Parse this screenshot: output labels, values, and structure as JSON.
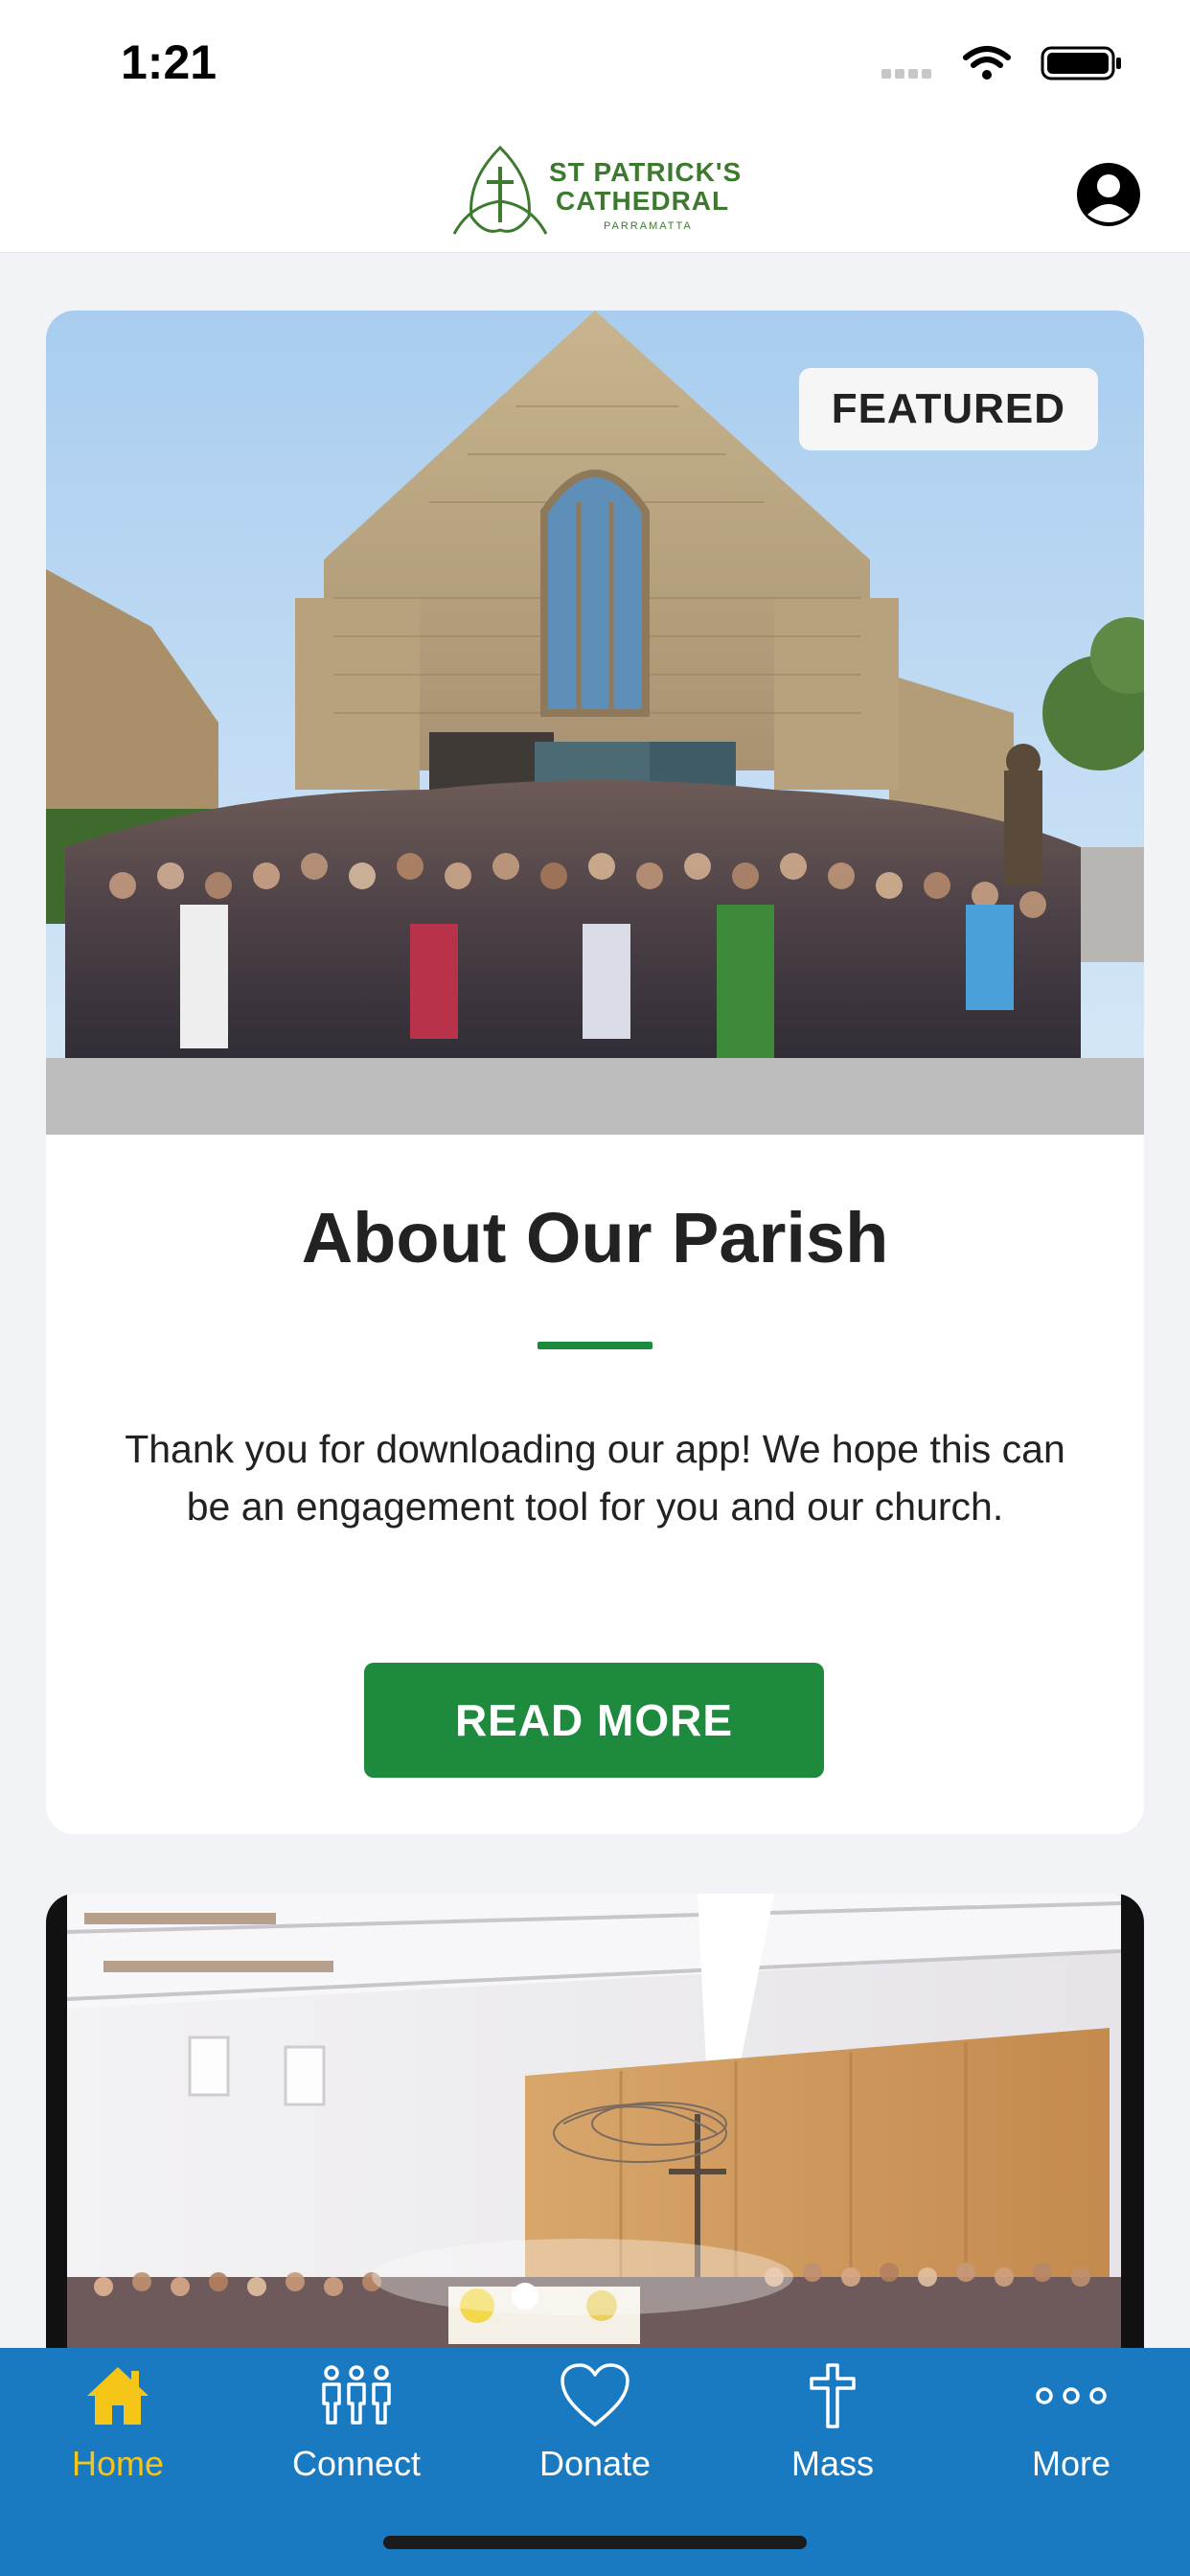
{
  "status_bar": {
    "time": "1:21"
  },
  "header": {
    "logo": {
      "line1": "ST PATRICK'S",
      "line2": "CATHEDRAL",
      "line3": "PARRAMATTA"
    }
  },
  "featured_card": {
    "badge": "FEATURED",
    "title": "About Our Parish",
    "body": "Thank you for downloading our app! We hope this can be an engagement tool for you and our church.",
    "button_label": "READ MORE"
  },
  "tabbar": {
    "items": [
      {
        "label": "Home",
        "icon": "home-icon",
        "active": true
      },
      {
        "label": "Connect",
        "icon": "people-icon",
        "active": false
      },
      {
        "label": "Donate",
        "icon": "heart-icon",
        "active": false
      },
      {
        "label": "Mass",
        "icon": "cross-icon",
        "active": false
      },
      {
        "label": "More",
        "icon": "more-dots-icon",
        "active": false
      }
    ]
  },
  "colors": {
    "brand_green": "#1e8a3e",
    "tabbar_blue": "#1a7ac1",
    "active_tab": "#f5c518",
    "logo_green": "#3d7a2f"
  }
}
